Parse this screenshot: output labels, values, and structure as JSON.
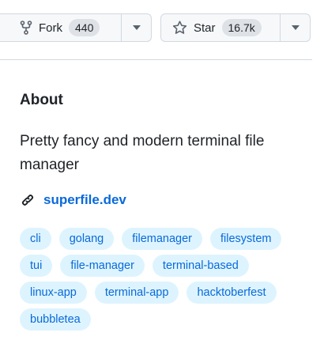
{
  "actions": {
    "fork": {
      "label": "Fork",
      "count": "440",
      "icon": "repo-forked-icon"
    },
    "star": {
      "label": "Star",
      "count": "16.7k",
      "icon": "star-icon"
    }
  },
  "about": {
    "title": "About",
    "description": "Pretty fancy and modern terminal file manager",
    "website": {
      "label": "superfile.dev",
      "icon": "link-icon"
    }
  },
  "topics": [
    [
      "cli",
      "golang",
      "filemanager",
      "filesystem"
    ],
    [
      "tui",
      "file-manager",
      "terminal-based"
    ],
    [
      "linux-app",
      "terminal-app",
      "hacktoberfest"
    ],
    [
      "bubbletea"
    ]
  ],
  "colors": {
    "link": "#0969da",
    "topic_bg": "#ddf4ff",
    "text": "#1f2328",
    "border": "#d1d9e0"
  }
}
